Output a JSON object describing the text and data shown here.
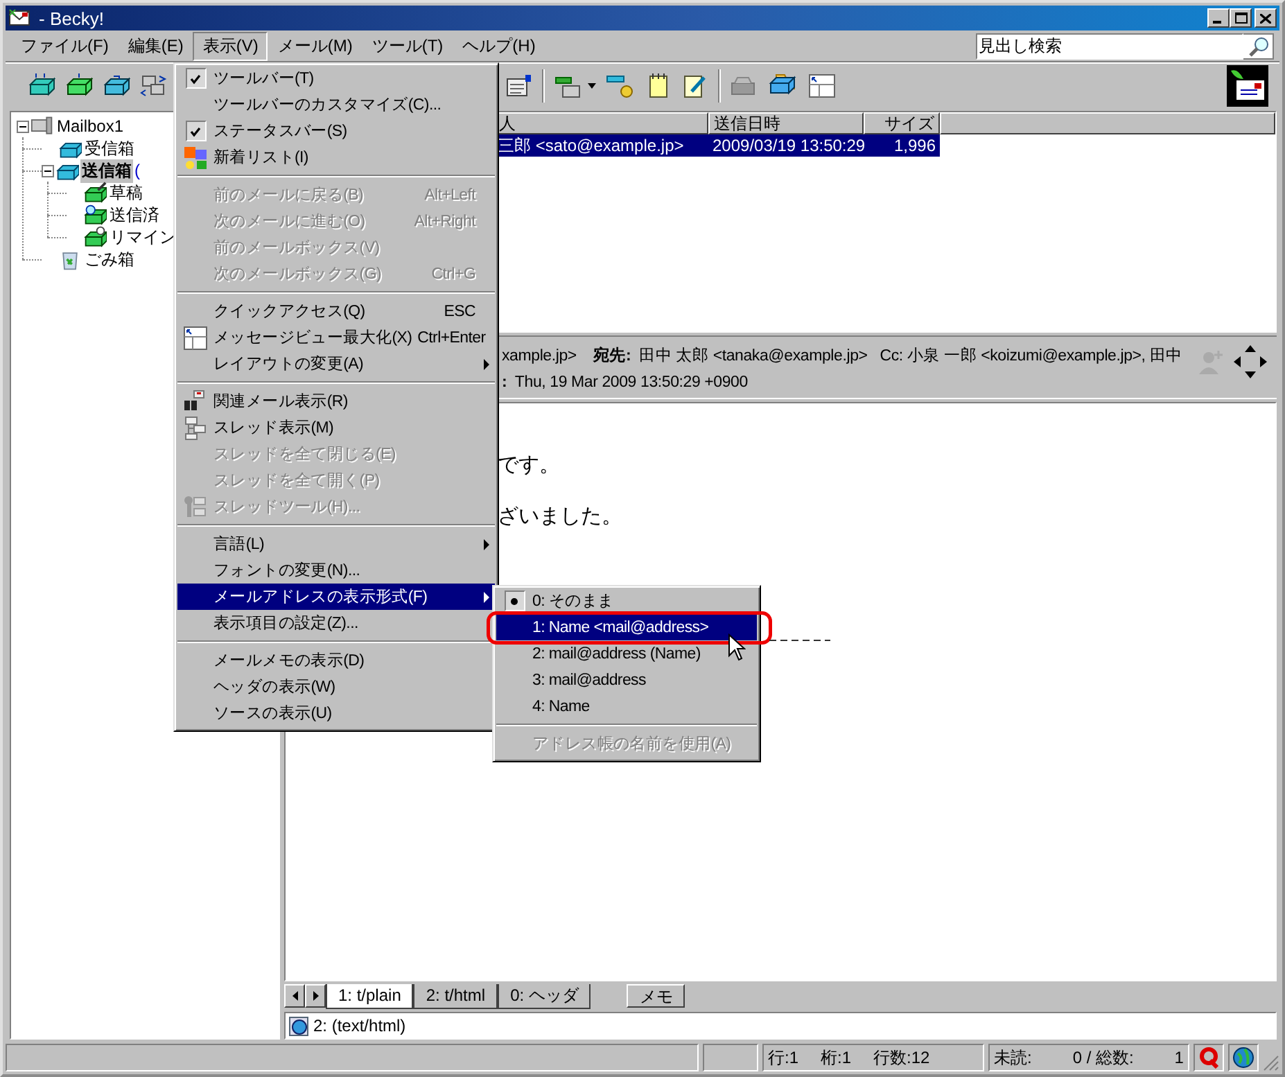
{
  "window": {
    "title": "- Becky!"
  },
  "menubar": [
    {
      "label": "ファイル(F)",
      "selected": false
    },
    {
      "label": "編集(E)",
      "selected": false
    },
    {
      "label": "表示(V)",
      "selected": true
    },
    {
      "label": "メール(M)",
      "selected": false
    },
    {
      "label": "ツール(T)",
      "selected": false
    },
    {
      "label": "ヘルプ(H)",
      "selected": false
    }
  ],
  "search": {
    "value": "見出し検索"
  },
  "folders": [
    {
      "kind": "mailbox",
      "label": "Mailbox1",
      "selected": false,
      "expanded": true,
      "children": [
        {
          "kind": "folder",
          "label": "受信箱",
          "selected": false
        },
        {
          "kind": "folder",
          "label": "送信箱",
          "count": "(",
          "selected": true,
          "expanded": true,
          "children": [
            {
              "kind": "draft",
              "label": "草稿",
              "selected": false
            },
            {
              "kind": "sent",
              "label": "送信済",
              "selected": false
            },
            {
              "kind": "reminder",
              "label": "リマイン",
              "selected": false
            }
          ]
        },
        {
          "kind": "trash",
          "label": "ごみ箱",
          "selected": false
        }
      ]
    }
  ],
  "message_list": {
    "columns": [
      "人",
      "送信日時",
      "サイズ"
    ],
    "rows": [
      {
        "cells": [
          "三郎 <sato@example.jp>",
          "2009/03/19 13:50:29",
          "1,996"
        ],
        "selected": true
      }
    ]
  },
  "header_pane": {
    "line_1": "xample.jp>    **宛先:**  田中 太郎 <tanaka@example.jp>   Cc: 小泉 一郎 <koizumi@example.jp>, 田中",
    "line_2": "**:**  Thu, 19 Mar 2009 13:50:29 +0900"
  },
  "body_lines": [
    "です。",
    "ざいました。"
  ],
  "part_tabs": [
    {
      "label": "1: t/plain",
      "selected": true
    },
    {
      "label": "2: t/html",
      "selected": false
    },
    {
      "label": "0: ヘッダ",
      "selected": false
    }
  ],
  "memo_button": "メモ",
  "attachments": [
    {
      "label": "2: (text/html)"
    }
  ],
  "status_bar": {
    "line": "行:1",
    "column": "桁:1",
    "line_count": "行数:12",
    "unread_label": "未読:",
    "unread": "0 / 総数:",
    "total": "1"
  },
  "view_menu": {
    "items": [
      {
        "kind": "item",
        "label": "ツールバー(T)",
        "checked": true,
        "disabled": false,
        "submenu": false,
        "selected": false
      },
      {
        "kind": "item",
        "label": "ツールバーのカスタマイズ(C)...",
        "checked": false,
        "disabled": false,
        "submenu": false,
        "selected": false
      },
      {
        "kind": "item",
        "label": "ステータスバー(S)",
        "checked": true,
        "disabled": false,
        "submenu": false,
        "selected": false
      },
      {
        "kind": "item",
        "label": "新着リスト(I)",
        "checked": false,
        "disabled": false,
        "submenu": false,
        "selected": false
      },
      {
        "kind": "separator"
      },
      {
        "kind": "item",
        "label": "前のメールに戻る(B)",
        "shortcut": "Alt+Left",
        "checked": false,
        "disabled": true,
        "submenu": false,
        "selected": false
      },
      {
        "kind": "item",
        "label": "次のメールに進む(O)",
        "shortcut": "Alt+Right",
        "checked": false,
        "disabled": true,
        "submenu": false,
        "selected": false
      },
      {
        "kind": "item",
        "label": "前のメールボックス(V)",
        "checked": false,
        "disabled": true,
        "submenu": false,
        "selected": false
      },
      {
        "kind": "item",
        "label": "次のメールボックス(G)",
        "shortcut": "Ctrl+G",
        "checked": false,
        "disabled": true,
        "submenu": false,
        "selected": false
      },
      {
        "kind": "separator"
      },
      {
        "kind": "item",
        "label": "クイックアクセス(Q)",
        "shortcut": "ESC",
        "checked": false,
        "disabled": false,
        "submenu": false,
        "selected": false
      },
      {
        "kind": "item",
        "label": "メッセージビュー最大化(X)",
        "shortcut": "Ctrl+Enter",
        "checked": false,
        "disabled": false,
        "submenu": false,
        "selected": false
      },
      {
        "kind": "item",
        "label": "レイアウトの変更(A)",
        "checked": false,
        "disabled": false,
        "submenu": true,
        "selected": false
      },
      {
        "kind": "separator"
      },
      {
        "kind": "item",
        "label": "関連メール表示(R)",
        "checked": false,
        "disabled": false,
        "submenu": false,
        "selected": false
      },
      {
        "kind": "item",
        "label": "スレッド表示(M)",
        "checked": false,
        "disabled": false,
        "submenu": false,
        "selected": false
      },
      {
        "kind": "item",
        "label": "スレッドを全て閉じる(E)",
        "checked": false,
        "disabled": true,
        "submenu": false,
        "selected": false
      },
      {
        "kind": "item",
        "label": "スレッドを全て開く(P)",
        "checked": false,
        "disabled": true,
        "submenu": false,
        "selected": false
      },
      {
        "kind": "item",
        "label": "スレッドツール(H)...",
        "checked": false,
        "disabled": true,
        "submenu": false,
        "selected": false
      },
      {
        "kind": "separator"
      },
      {
        "kind": "item",
        "label": "言語(L)",
        "checked": false,
        "disabled": false,
        "submenu": true,
        "selected": false
      },
      {
        "kind": "item",
        "label": "フォントの変更(N)...",
        "checked": false,
        "disabled": false,
        "submenu": false,
        "selected": false
      },
      {
        "kind": "item",
        "label": "メールアドレスの表示形式(F)",
        "checked": false,
        "disabled": false,
        "submenu": true,
        "selected": true
      },
      {
        "kind": "item",
        "label": "表示項目の設定(Z)...",
        "checked": false,
        "disabled": false,
        "submenu": false,
        "selected": false
      },
      {
        "kind": "separator"
      },
      {
        "kind": "item",
        "label": "メールメモの表示(D)",
        "checked": false,
        "disabled": false,
        "submenu": false,
        "selected": false
      },
      {
        "kind": "item",
        "label": "ヘッダの表示(W)",
        "checked": false,
        "disabled": false,
        "submenu": false,
        "selected": false
      },
      {
        "kind": "item",
        "label": "ソースの表示(U)",
        "checked": false,
        "disabled": false,
        "submenu": false,
        "selected": false
      }
    ]
  },
  "address_menu": {
    "items": [
      {
        "kind": "item",
        "label": "0: そのまま",
        "checked": true,
        "disabled": false,
        "submenu": false,
        "selected": false
      },
      {
        "kind": "item",
        "label": "1: Name <mail@address>",
        "checked": false,
        "disabled": false,
        "submenu": false,
        "selected": true
      },
      {
        "kind": "item",
        "label": "2: mail@address (Name)",
        "checked": false,
        "disabled": false,
        "submenu": false,
        "selected": false
      },
      {
        "kind": "item",
        "label": "3: mail@address",
        "checked": false,
        "disabled": false,
        "submenu": false,
        "selected": false
      },
      {
        "kind": "item",
        "label": "4: Name",
        "checked": false,
        "disabled": false,
        "submenu": false,
        "selected": false
      },
      {
        "kind": "separator"
      },
      {
        "kind": "item",
        "label": "アドレス帳の名前を使用(A)",
        "checked": false,
        "disabled": true,
        "submenu": false,
        "selected": false
      }
    ]
  }
}
